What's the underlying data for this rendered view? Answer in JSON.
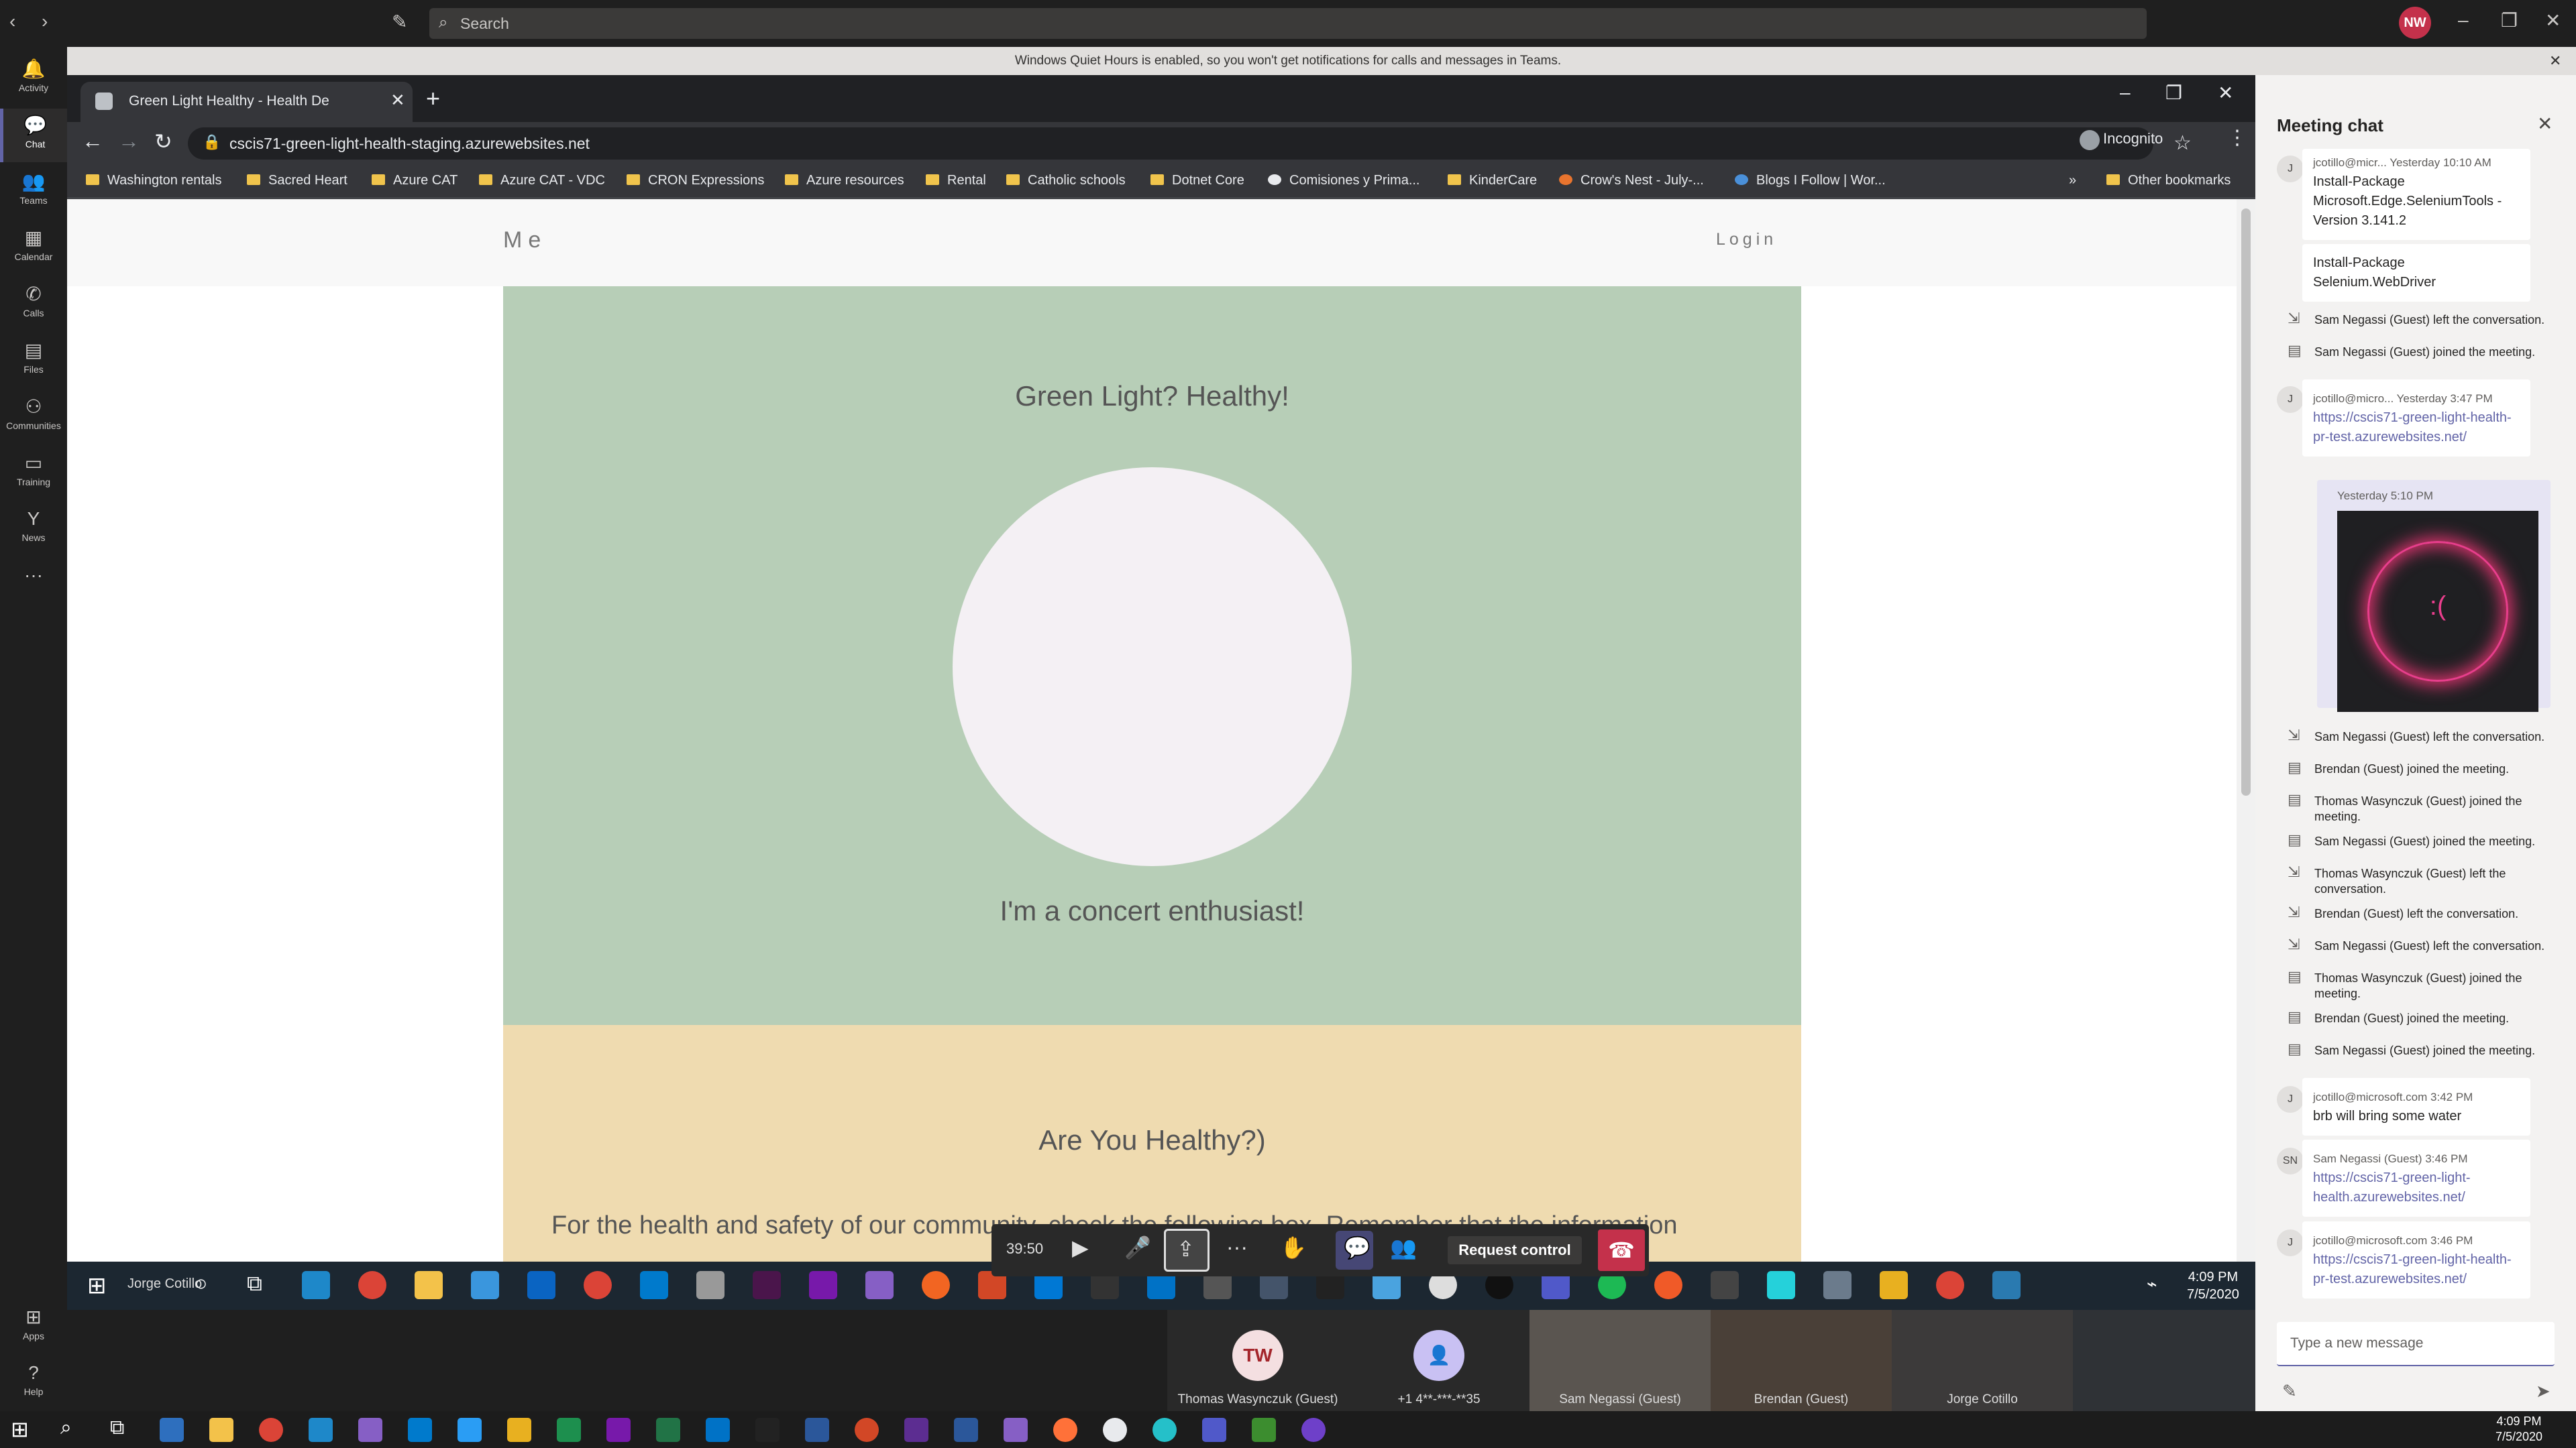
{
  "teams": {
    "search_placeholder": "Search",
    "avatar_initials": "NW",
    "quiet_banner": "Windows Quiet Hours is enabled, so you won't get notifications for calls and messages in Teams.",
    "rail": [
      "Activity",
      "Chat",
      "Teams",
      "Calendar",
      "Calls",
      "Files",
      "Communities",
      "Training",
      "News",
      "Apps",
      "Help"
    ]
  },
  "browser": {
    "tab_title": "Green Light Healthy - Health De",
    "url": "cscis71-green-light-health-staging.azurewebsites.net",
    "profile_label": "Incognito",
    "bookmarks": [
      "Washington rentals",
      "Sacred Heart",
      "Azure CAT",
      "Azure CAT - VDC",
      "CRON Expressions",
      "Azure resources",
      "Rental",
      "Catholic schools",
      "Dotnet Core",
      "Comisiones y Prima...",
      "KinderCare",
      "Crow's Nest - July-...",
      "Blogs I Follow | Wor..."
    ],
    "other_bookmarks": "Other bookmarks"
  },
  "site": {
    "brand": "Me",
    "login": "Login",
    "hero_title": "Green Light? Healthy!",
    "hero_subtitle": "I'm a concert enthusiast!",
    "section_title": "Are You Healthy?)",
    "section_body": "For the health and safety of our community, check the following box. Remember that the information"
  },
  "call": {
    "timer": "39:50",
    "request_control": "Request control"
  },
  "participants": [
    {
      "initials": "TW",
      "name": "Thomas Wasynczuk (Guest)",
      "color": "#f4dfe1",
      "text_color": "#a4262c"
    },
    {
      "name": "+1 4**-***-**35",
      "color": "#c9c1f3"
    }
  ],
  "video_names": [
    "Sam Negassi (Guest)",
    "Brendan (Guest)",
    "Jorge Cotillo"
  ],
  "share_taskbar": {
    "start_label": "Jorge Cotillo",
    "time": "4:09 PM",
    "date": "7/5/2020"
  },
  "chat": {
    "header": "Meeting chat",
    "msg1_meta": "jcotillo@micr...   Yesterday 10:10 AM",
    "msg1_text": "Install-Package Microsoft.Edge.SeleniumTools - Version 3.141.2",
    "msg2_text": "Install-Package Selenium.WebDriver",
    "sys1": "Sam Negassi (Guest) left the conversation.",
    "sys2": "Sam Negassi (Guest) joined the meeting.",
    "msg3_meta": "jcotillo@micro...   Yesterday 3:47 PM",
    "msg3_link": "https://cscis71-green-light-health-pr-test.azurewebsites.net/",
    "image_meta": "Yesterday 5:10 PM",
    "image_face": ":(",
    "events": [
      "Sam Negassi (Guest) left the conversation.",
      "Brendan (Guest) joined the meeting.",
      "Thomas Wasynczuk (Guest) joined the meeting.",
      "Sam Negassi (Guest) joined the meeting.",
      "Thomas Wasynczuk (Guest) left the conversation.",
      "Brendan (Guest) left the conversation.",
      "Sam Negassi (Guest) left the conversation.",
      "Thomas Wasynczuk (Guest) joined the meeting.",
      "Brendan (Guest) joined the meeting.",
      "Sam Negassi (Guest) joined the meeting."
    ],
    "msg4_meta": "jcotillo@microsoft.com   3:42 PM",
    "msg4_text": "brb will bring some water",
    "msg5_meta": "Sam Negassi (Guest)   3:46 PM",
    "msg5_link": "https://cscis71-green-light-health.azurewebsites.net/",
    "msg6_meta": "jcotillo@microsoft.com   3:46 PM",
    "msg6_link": "https://cscis71-green-light-health-pr-test.azurewebsites.net/",
    "compose_placeholder": "Type a new message",
    "avatar_j": "J",
    "avatar_sn": "SN"
  },
  "win_taskbar": {
    "time": "4:09 PM",
    "date": "7/5/2020"
  }
}
